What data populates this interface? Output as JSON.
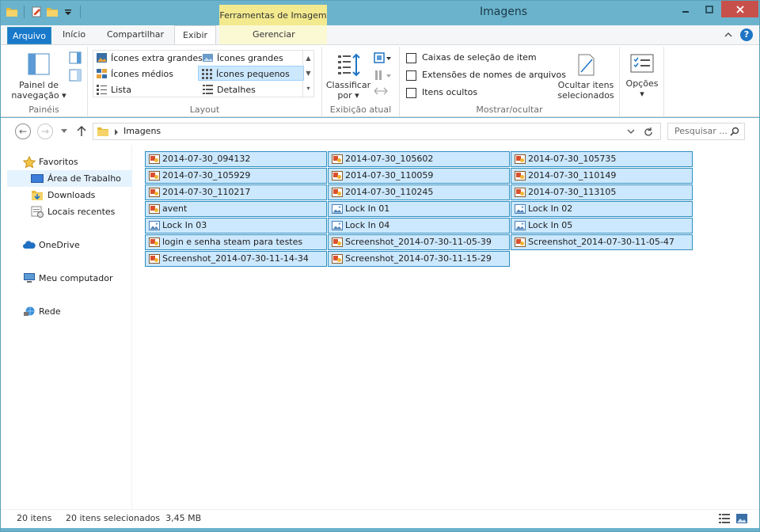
{
  "window": {
    "title": "Imagens",
    "context_tab_group": "Ferramentas de Imagem"
  },
  "tabs": {
    "file": "Arquivo",
    "home": "Início",
    "share": "Compartilhar",
    "view": "Exibir",
    "manage": "Gerenciar"
  },
  "ribbon": {
    "panes": {
      "nav_pane_line1": "Painel de",
      "nav_pane_line2": "navegação",
      "label": "Painéis"
    },
    "layout": {
      "label": "Layout",
      "items": [
        "Ícones extra grandes",
        "Ícones grandes",
        "Ícones médios",
        "Ícones pequenos",
        "Lista",
        "Detalhes"
      ],
      "selected": "Ícones pequenos"
    },
    "current_view": {
      "sort_line1": "Classificar",
      "sort_line2": "por",
      "label": "Exibição atual"
    },
    "show_hide": {
      "item_checkboxes": "Caixas de seleção de item",
      "file_extensions": "Extensões de nomes de arquivos",
      "hidden_items": "Itens ocultos",
      "hide_selected_line1": "Ocultar itens",
      "hide_selected_line2": "selecionados",
      "label": "Mostrar/ocultar"
    },
    "options": "Opções"
  },
  "address": {
    "path": "Imagens",
    "search_placeholder": "Pesquisar ..."
  },
  "nav_pane": {
    "favorites": "Favoritos",
    "desktop": "Área de Trabalho",
    "downloads": "Downloads",
    "recent": "Locais recentes",
    "onedrive": "OneDrive",
    "computer": "Meu computador",
    "network": "Rede"
  },
  "files": [
    "2014-07-30_094132",
    "2014-07-30_105602",
    "2014-07-30_105735",
    "2014-07-30_105929",
    "2014-07-30_110059",
    "2014-07-30_110149",
    "2014-07-30_110217",
    "2014-07-30_110245",
    "2014-07-30_113105",
    "avent",
    "Lock In 01",
    "Lock In 02",
    "Lock In 03",
    "Lock In 04",
    "Lock In 05",
    "login e senha steam para testes",
    "Screenshot_2014-07-30-11-05-39",
    "Screenshot_2014-07-30-11-05-47",
    "Screenshot_2014-07-30-11-14-34",
    "Screenshot_2014-07-30-11-15-29"
  ],
  "file_types": [
    "paint",
    "paint",
    "paint",
    "paint",
    "paint",
    "paint",
    "paint",
    "paint",
    "paint",
    "paint",
    "photo",
    "photo",
    "photo",
    "photo",
    "photo",
    "paint",
    "paint",
    "paint",
    "paint",
    "paint"
  ],
  "status": {
    "count": "20 itens",
    "selected": "20 itens selecionados  3,45 MB"
  },
  "colors": {
    "accent": "#1979ca",
    "selection_fill": "#cce8ff",
    "selection_border": "#2f8fc0",
    "frame": "#6bb3cc",
    "context_tab": "#f3ea8f"
  }
}
